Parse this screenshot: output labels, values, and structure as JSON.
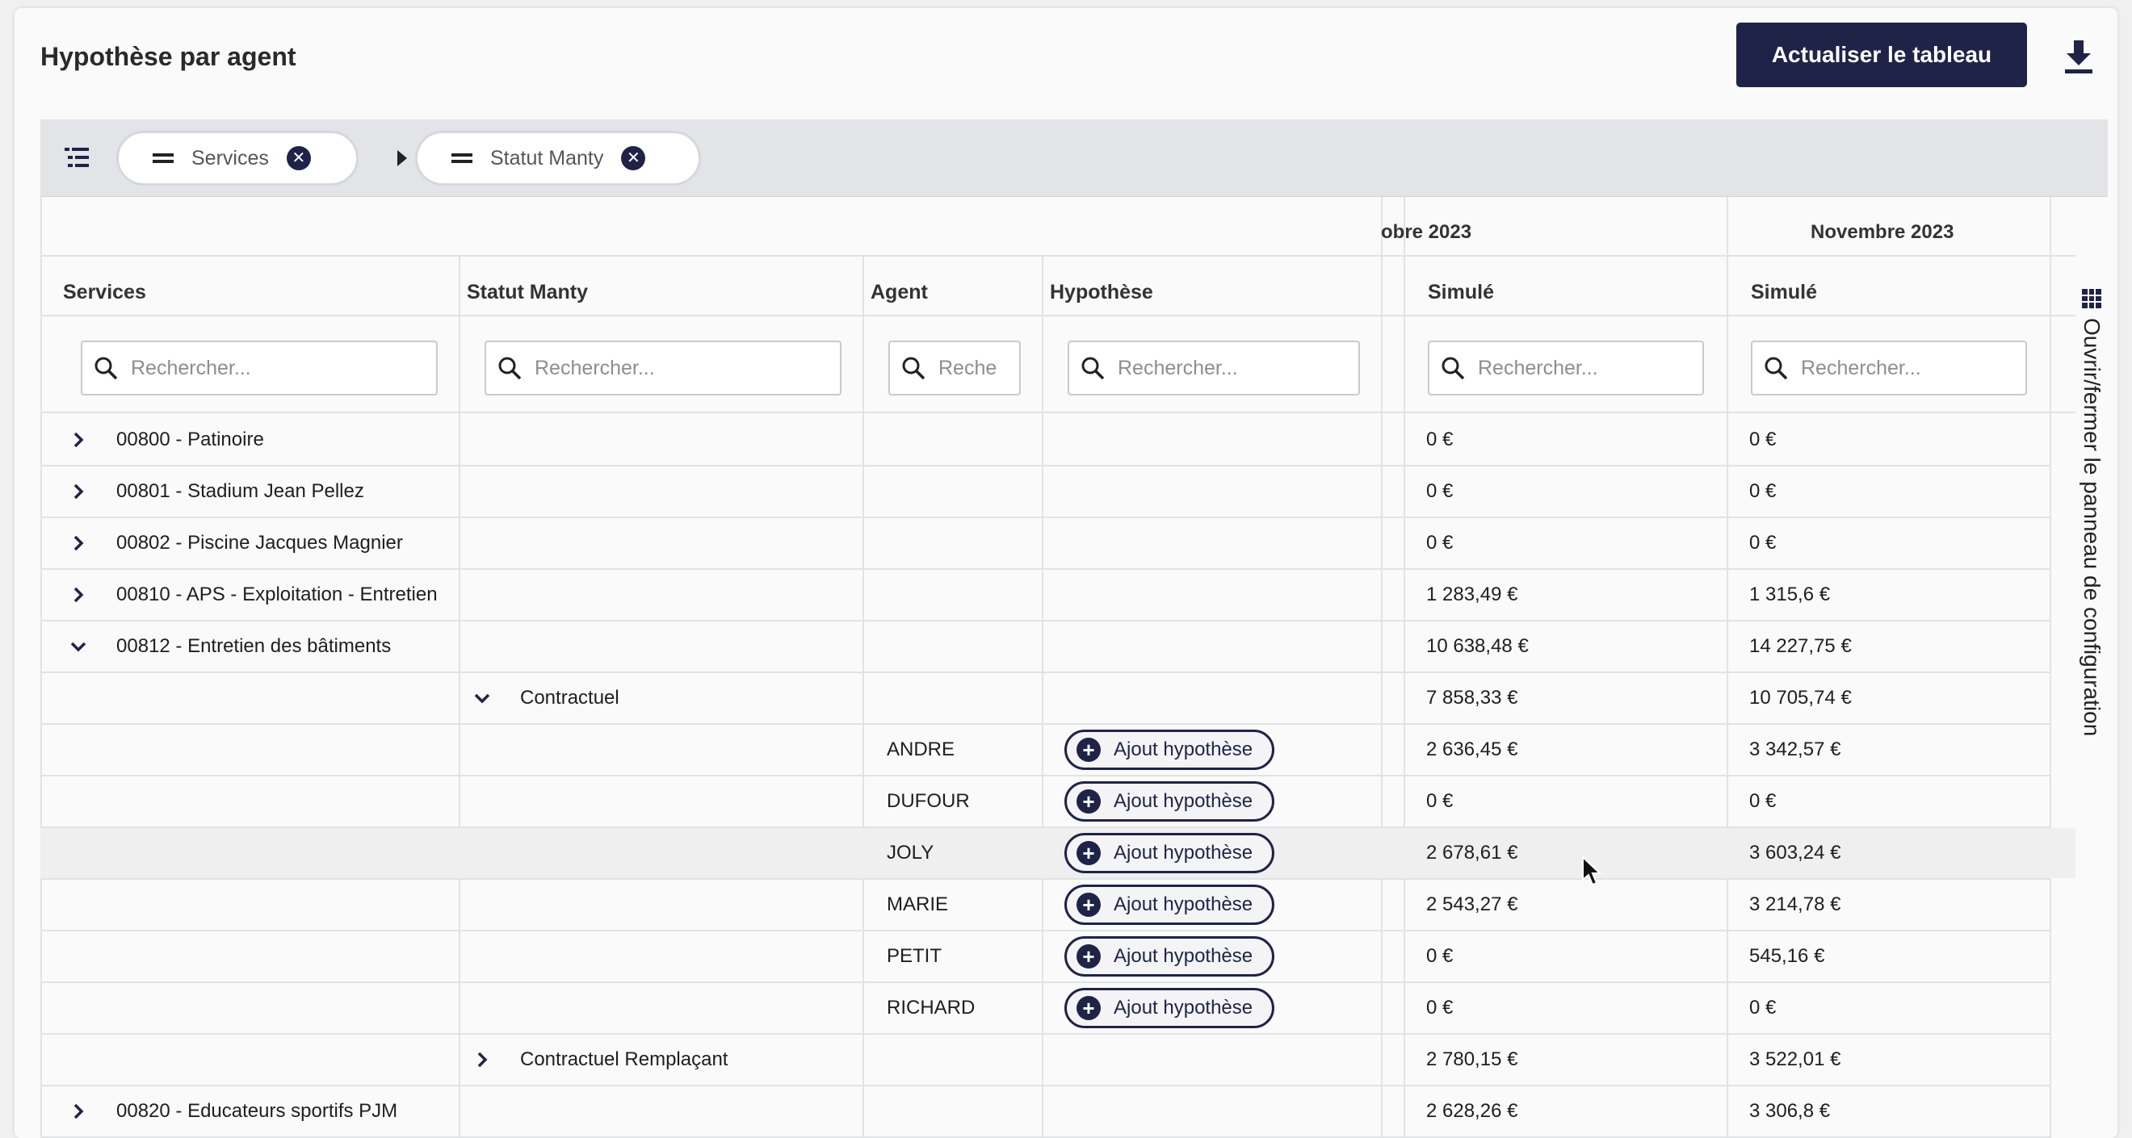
{
  "header": {
    "title": "Hypothèse par agent",
    "refresh_label": "Actualiser le tableau"
  },
  "grouping": {
    "chips": [
      {
        "label": "Services"
      },
      {
        "label": "Statut Manty"
      }
    ]
  },
  "months": [
    "obre 2023",
    "Novembre 2023"
  ],
  "columns": {
    "services": "Services",
    "statut": "Statut Manty",
    "agent": "Agent",
    "hypothese": "Hypothèse",
    "simule1": "Simulé",
    "simule2": "Simulé"
  },
  "search": {
    "placeholder": "Rechercher...",
    "agent_placeholder": "Reche"
  },
  "hypothesis_button_label": "Ajout hypothèse",
  "rows": [
    {
      "type": "service",
      "expanded": false,
      "label": "00800 - Patinoire",
      "m1": "0 €",
      "m2": "0 €"
    },
    {
      "type": "service",
      "expanded": false,
      "label": "00801 - Stadium Jean Pellez",
      "m1": "0 €",
      "m2": "0 €"
    },
    {
      "type": "service",
      "expanded": false,
      "label": "00802 - Piscine Jacques Magnier",
      "m1": "0 €",
      "m2": "0 €"
    },
    {
      "type": "service",
      "expanded": false,
      "label": "00810 - APS - Exploitation - Entretien",
      "m1": "1 283,49 €",
      "m2": "1 315,6 €"
    },
    {
      "type": "service",
      "expanded": true,
      "label": "00812 - Entretien des bâtiments",
      "m1": "10 638,48 €",
      "m2": "14 227,75 €"
    },
    {
      "type": "statut",
      "expanded": true,
      "label": "Contractuel",
      "m1": "7 858,33 €",
      "m2": "10 705,74 €"
    },
    {
      "type": "agent",
      "label": "ANDRE",
      "m1": "2 636,45 €",
      "m2": "3 342,57 €"
    },
    {
      "type": "agent",
      "label": "DUFOUR",
      "m1": "0 €",
      "m2": "0 €"
    },
    {
      "type": "agent",
      "label": "JOLY",
      "m1": "2 678,61 €",
      "m2": "3 603,24 €",
      "hover": true
    },
    {
      "type": "agent",
      "label": "MARIE",
      "m1": "2 543,27 €",
      "m2": "3 214,78 €"
    },
    {
      "type": "agent",
      "label": "PETIT",
      "m1": "0 €",
      "m2": "545,16 €"
    },
    {
      "type": "agent",
      "label": "RICHARD",
      "m1": "0 €",
      "m2": "0 €"
    },
    {
      "type": "statut",
      "expanded": false,
      "label": "Contractuel Remplaçant",
      "m1": "2 780,15 €",
      "m2": "3 522,01 €"
    },
    {
      "type": "service",
      "expanded": false,
      "label": "00820 - Educateurs sportifs PJM",
      "m1": "2 628,26 €",
      "m2": "3 306,8 €"
    }
  ],
  "side_panel": {
    "label": "Ouvrir/fermer le panneau de configuration"
  },
  "icons": {
    "download": "download-icon",
    "group_menu": "group-list-icon",
    "search": "search-icon",
    "side": "grid-icon"
  },
  "colors": {
    "accent": "#1f2347"
  }
}
